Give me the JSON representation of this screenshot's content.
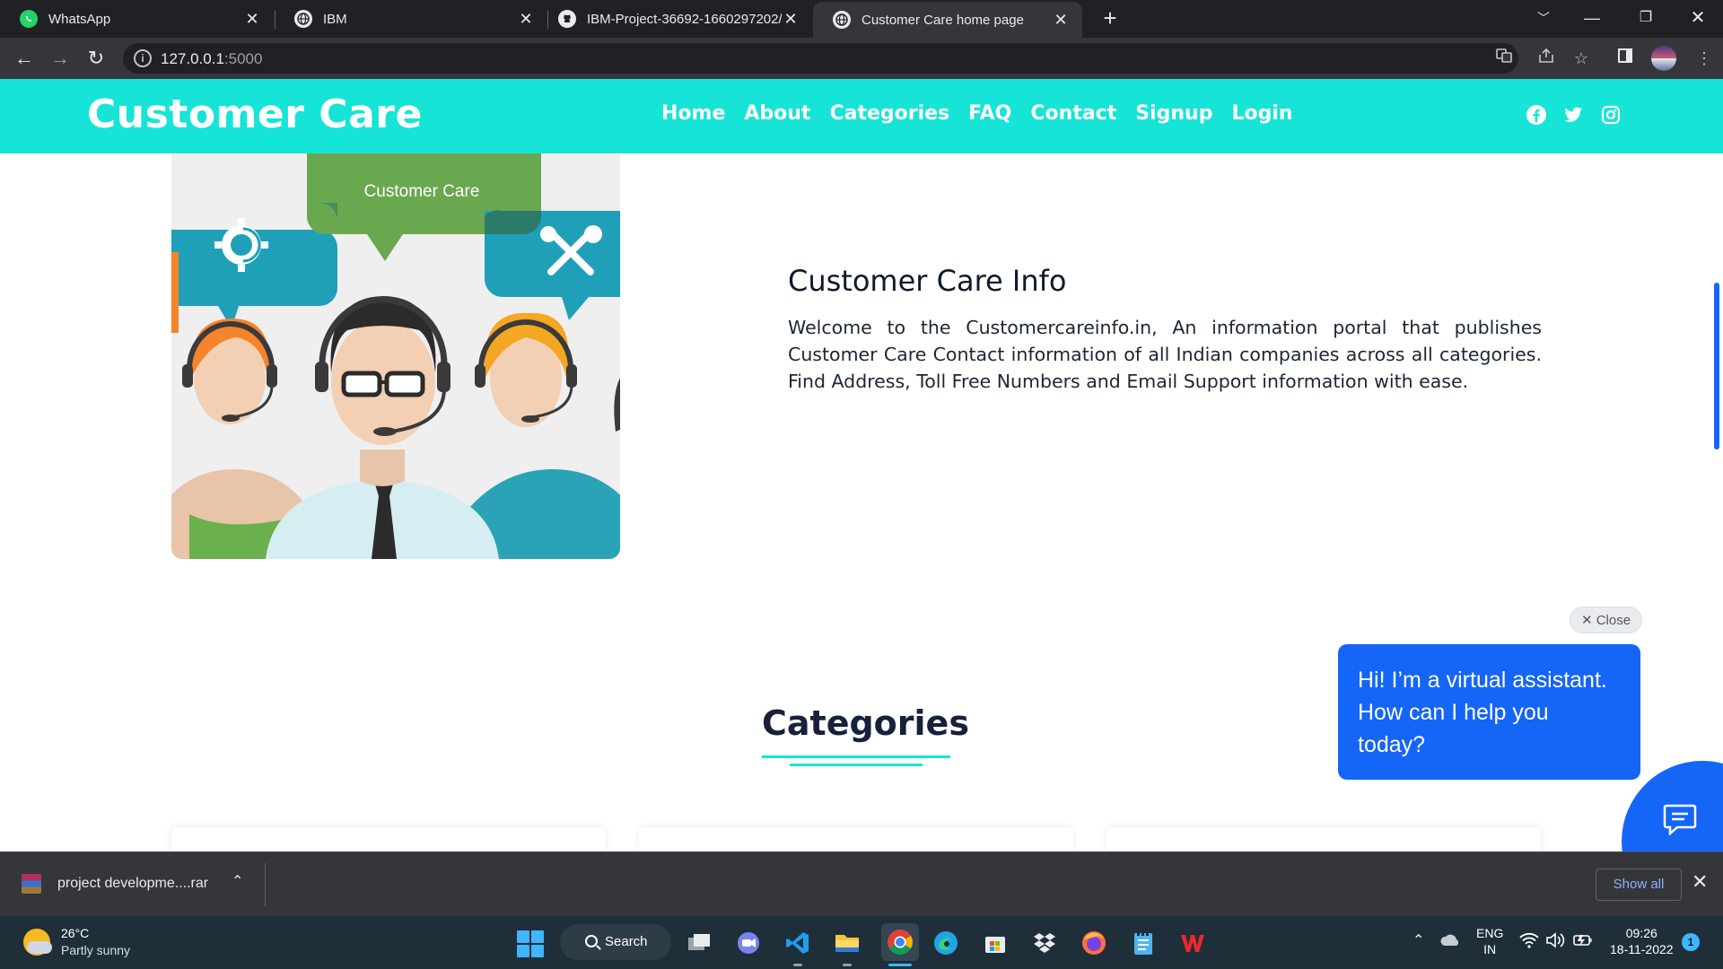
{
  "browser": {
    "tabs": [
      {
        "title": "WhatsApp",
        "icon": "whatsapp-icon"
      },
      {
        "title": "IBM",
        "icon": "globe-icon"
      },
      {
        "title": "IBM-Project-36692-1660297202/",
        "icon": "github-icon"
      },
      {
        "title": "Customer Care home page",
        "icon": "globe-icon"
      }
    ],
    "active_tab": 3,
    "url": {
      "host": "127.0.0.1",
      "port": ":5000"
    }
  },
  "site": {
    "brand": "Customer Care",
    "nav": [
      "Home",
      "About",
      "Categories",
      "FAQ",
      "Contact",
      "Signup",
      "Login"
    ],
    "social": [
      "facebook-icon",
      "twitter-icon",
      "instagram-icon"
    ],
    "accent_color": "#16e4d6",
    "hero_image": {
      "bubble_text": "Customer Care"
    },
    "info": {
      "title": "Customer Care Info",
      "text": "Welcome to the Customercareinfo.in, An information portal that publishes Customer Care Contact information of all Indian companies across all categories. Find Address, Toll Free Numbers and Email Support information with ease."
    },
    "categories_title": "Categories"
  },
  "chat": {
    "close_label": "Close",
    "message": "Hi! I’m a virtual assistant. How can I help you today?",
    "color": "#1565f7"
  },
  "downloads": {
    "file": "project developme....rar",
    "show_all": "Show all"
  },
  "taskbar": {
    "weather": {
      "temp": "26°C",
      "desc": "Partly sunny"
    },
    "search": "Search",
    "lang": {
      "line1": "ENG",
      "line2": "IN"
    },
    "time": "09:26",
    "date": "18-11-2022",
    "notifications": "1"
  }
}
